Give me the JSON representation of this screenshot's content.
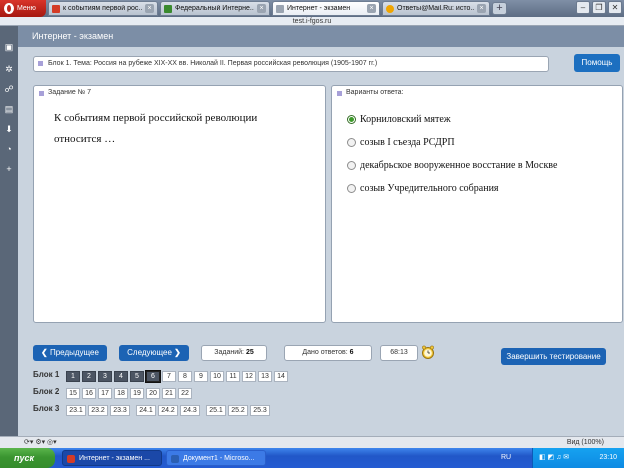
{
  "browser": {
    "menu_label": "Меню",
    "tabs": [
      {
        "title": "к событиям первой рос...",
        "active": false,
        "favicon_color": "#d33b26"
      },
      {
        "title": "Федеральный Интерне...",
        "active": false,
        "favicon_color": "#3a8a2e"
      },
      {
        "title": "Интернет - экзамен",
        "active": true,
        "favicon_color": "#9aa4b1"
      },
      {
        "title": "Ответы@Mail.Ru: исто...",
        "active": false,
        "favicon_color": "#f0a500"
      }
    ],
    "new_tab_label": "+",
    "url": "test.i-fgos.ru",
    "status_zoom": "Вид (100%)"
  },
  "app": {
    "header_title": "Интернет - экзамен",
    "block_title": "Блок 1. Тема: Россия на рубеже XIX-XX вв. Николай II. Первая российская революция (1905-1907 гг.)",
    "help_label": "Помощь",
    "task_title": "Задание № 7",
    "question": "К событиям первой российской революции относится …",
    "answers_title": "Варианты ответа:",
    "options": [
      {
        "text": "Корниловский мятеж",
        "selected": true
      },
      {
        "text": "созыв I съезда РСДРП",
        "selected": false
      },
      {
        "text": "декабрьское вооруженное восстание в Москве",
        "selected": false
      },
      {
        "text": "созыв Учредительного собрания",
        "selected": false
      }
    ],
    "prev_label": "Предыдущее",
    "next_label": "Следующее",
    "tasks_label": "Заданий:",
    "tasks_count": "25",
    "answered_label": "Дано ответов:",
    "answered_count": "6",
    "timer": "68:13",
    "finish_label": "Завершить тестирование",
    "blocks": [
      {
        "label": "Блок 1",
        "cells": [
          "1",
          "2",
          "3",
          "4",
          "5",
          "6",
          "7",
          "8",
          "9",
          "10",
          "11",
          "12",
          "13",
          "14"
        ],
        "done_count": 6
      },
      {
        "label": "Блок 2",
        "cells": [
          "15",
          "16",
          "17",
          "18",
          "19",
          "20",
          "21",
          "22"
        ],
        "done_count": 0
      },
      {
        "label": "Блок 3",
        "cells": [
          "23.1",
          "23.2",
          "23.3",
          "24.1",
          "24.2",
          "24.3",
          "25.1",
          "25.2",
          "25.3"
        ],
        "done_count": 0
      }
    ]
  },
  "taskbar": {
    "start_label": "пуск",
    "windows": [
      {
        "title": "Интернет - экзамен ...",
        "icon_color": "#d33b26"
      },
      {
        "title": "Документ1 - Microso...",
        "icon_color": "#2b5fb3"
      }
    ],
    "lang": "RU",
    "time": "23:10"
  },
  "colors": {
    "accent": "#1c63b4",
    "header": "#7c8ea6",
    "selected_radio": "#3e9b2b"
  }
}
